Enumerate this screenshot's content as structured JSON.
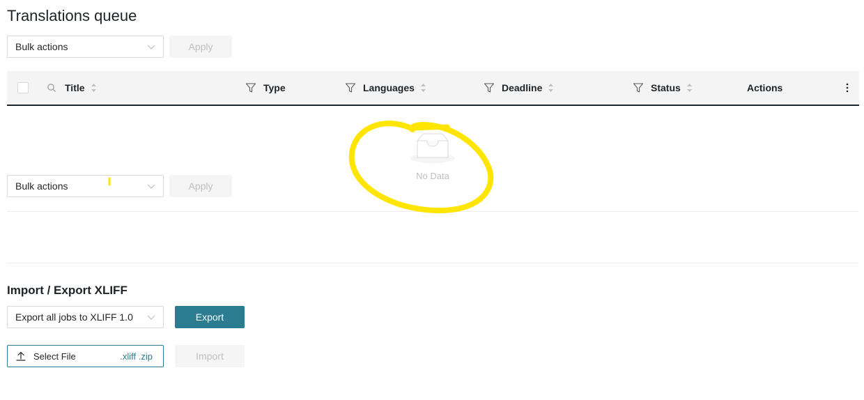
{
  "page": {
    "title": "Translations queue"
  },
  "bulk_top": {
    "select_value": "Bulk actions",
    "apply_label": "Apply"
  },
  "bulk_bottom": {
    "select_value": "Bulk actions",
    "apply_label": "Apply"
  },
  "table": {
    "columns": [
      {
        "label": "Title",
        "icon": "search-icon",
        "sortable": true
      },
      {
        "label": "Type",
        "icon": "filter-icon",
        "sortable": false
      },
      {
        "label": "Languages",
        "icon": "filter-icon",
        "sortable": true
      },
      {
        "label": "Deadline",
        "icon": "filter-icon",
        "sortable": true
      },
      {
        "label": "Status",
        "icon": "filter-icon",
        "sortable": true
      },
      {
        "label": "Actions",
        "icon": "",
        "sortable": false
      }
    ],
    "menu_icon": "more-vertical-icon",
    "empty_text": "No Data"
  },
  "xliff": {
    "title": "Import / Export XLIFF",
    "export_select_value": "Export all jobs to XLIFF 1.0",
    "export_label": "Export",
    "select_file_label": "Select File",
    "file_types": ".xliff .zip",
    "import_label": "Import"
  },
  "colors": {
    "primary": "#2c7c91",
    "highlight": "#ffe500",
    "disabled_bg": "#f5f5f5",
    "disabled_text": "#bfbfbf"
  }
}
